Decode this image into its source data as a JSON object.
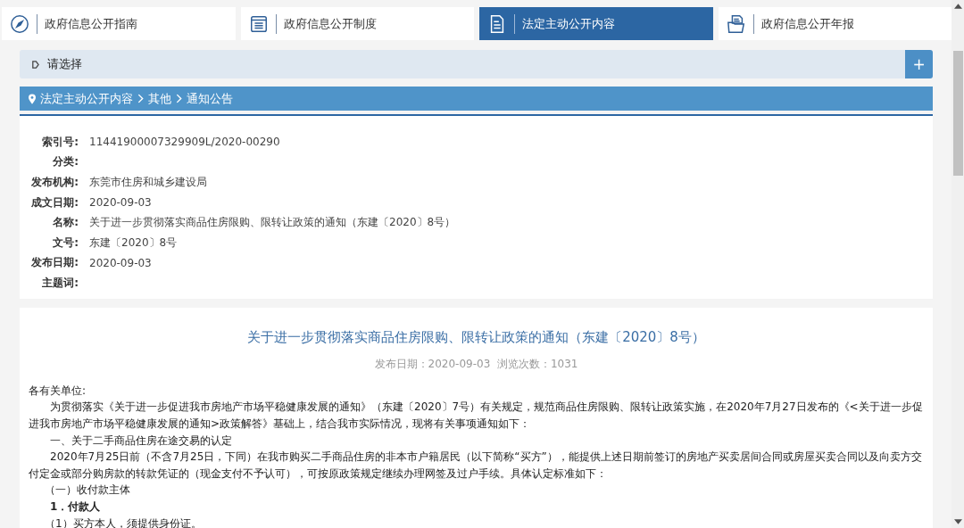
{
  "tabs": [
    {
      "label": "政府信息公开指南",
      "kind": "compass",
      "selected": false
    },
    {
      "label": "政府信息公开制度",
      "kind": "list",
      "selected": false
    },
    {
      "label": "法定主动公开内容",
      "kind": "document",
      "selected": true
    },
    {
      "label": "政府信息公开年报",
      "kind": "folder",
      "selected": false
    }
  ],
  "selector": {
    "label": "请选择",
    "button": "+"
  },
  "breadcrumb": [
    "法定主动公开内容",
    "其他",
    "通知公告"
  ],
  "metadata": [
    {
      "label": "索引号:",
      "value": "11441900007329909L/2020-00290"
    },
    {
      "label": "分类:"
    },
    {
      "label": "发布机构:",
      "value": "东莞市住房和城乡建设局"
    },
    {
      "label": "成文日期:",
      "value": "2020-09-03"
    },
    {
      "label": "名称:",
      "value": "关于进一步贯彻落实商品住房限购、限转让政策的通知（东建〔2020〕8号）"
    },
    {
      "label": "文号:",
      "value": "东建〔2020〕8号"
    },
    {
      "label": "发布日期:",
      "value": "2020-09-03"
    },
    {
      "label": "主题词:"
    }
  ],
  "article": {
    "title": "关于进一步贯彻落实商品住房限购、限转让政策的通知（东建〔2020〕8号）",
    "info": "发布日期：2020-09-03  浏览次数：1031",
    "paragraphs": [
      {
        "kind": "plain",
        "text": "各有关单位:"
      },
      {
        "kind": "indent",
        "text": "为贯彻落实《关于进一步促进我市房地产市场平稳健康发展的通知》（东建〔2020〕7号）有关规定，规范商品住房限购、限转让政策实施，在2020年7月27日发布的《<关于进一步促进我市房地产市场平稳健康发展的通知>政策解答》基础上，结合我市实际情况，现将有关事项通知如下："
      },
      {
        "kind": "indent",
        "text": "一、关于二手商品住房在途交易的认定"
      },
      {
        "kind": "indent",
        "text": "2020年7月25日前（不含7月25日，下同）在我市购买二手商品住房的非本市户籍居民（以下简称“买方”），能提供上述日期前签订的房地产买卖居间合同或房屋买卖合同以及向卖方交付定金或部分购房款的转款凭证的（现金支付不予认可），可按原政策规定继续办理网签及过户手续。具体认定标准如下："
      },
      {
        "kind": "sub",
        "text": "（一）收付款主体"
      },
      {
        "kind": "bold",
        "text": "1．付款人"
      },
      {
        "kind": "sub",
        "text": "（1）买方本人，须提供身份证。"
      }
    ]
  }
}
